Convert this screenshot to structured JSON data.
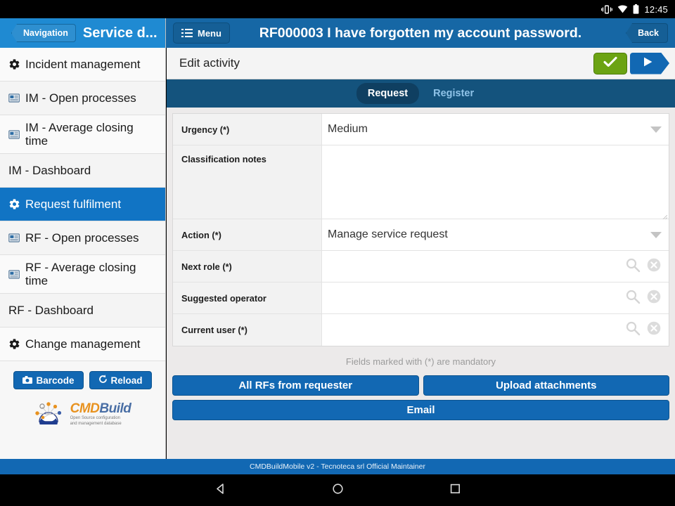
{
  "statusbar": {
    "time": "12:45",
    "icons": [
      "vibrate-icon",
      "wifi-icon",
      "battery-icon"
    ]
  },
  "appbar": {
    "navigation_label": "Navigation",
    "service_title": "Service d...",
    "menu_label": "Menu",
    "record_title": "RF000003 I have forgotten my account password.",
    "back_label": "Back"
  },
  "sidebar": {
    "items": [
      {
        "label": "Incident management",
        "icon": "gear-icon",
        "active": false
      },
      {
        "label": "IM - Open processes",
        "icon": "report-icon",
        "active": false
      },
      {
        "label": "IM - Average closing time",
        "icon": "report-icon",
        "active": false
      },
      {
        "label": "IM - Dashboard",
        "icon": "none",
        "active": false
      },
      {
        "label": "Request fulfilment",
        "icon": "gear-icon",
        "active": true
      },
      {
        "label": "RF - Open processes",
        "icon": "report-icon",
        "active": false
      },
      {
        "label": "RF - Average closing time",
        "icon": "report-icon",
        "active": false
      },
      {
        "label": "RF - Dashboard",
        "icon": "none",
        "active": false
      },
      {
        "label": "Change management",
        "icon": "gear-icon",
        "active": false
      }
    ],
    "barcode_label": "Barcode",
    "reload_label": "Reload",
    "logo": {
      "part1": "CMD",
      "part2": "Build",
      "tagline_line1": "Open Source configuration",
      "tagline_line2": "and management database"
    }
  },
  "content": {
    "header_title": "Edit activity",
    "confirm_icon": "check-icon",
    "advance_icon": "play-arrow-icon",
    "tabs": [
      {
        "label": "Request",
        "active": true
      },
      {
        "label": "Register",
        "active": false
      }
    ],
    "fields": [
      {
        "label": "Urgency (*)",
        "value": "Medium",
        "control": "dropdown"
      },
      {
        "label": "Classification notes",
        "value": "",
        "control": "textarea"
      },
      {
        "label": "Action (*)",
        "value": "Manage service request",
        "control": "dropdown"
      },
      {
        "label": "Next role (*)",
        "value": "",
        "control": "lookup"
      },
      {
        "label": "Suggested operator",
        "value": "",
        "control": "lookup"
      },
      {
        "label": "Current user (*)",
        "value": "",
        "control": "lookup"
      }
    ],
    "mandatory_note": "Fields marked with (*) are mandatory",
    "buttons": [
      {
        "label": "All RFs from requester"
      },
      {
        "label": "Upload attachments"
      },
      {
        "label": "Email"
      }
    ]
  },
  "footer": {
    "text": "CMDBuildMobile v2 - Tecnoteca srl Official Maintainer"
  },
  "navbar": {
    "back": "back-triangle-icon",
    "home": "home-circle-icon",
    "recents": "recents-square-icon"
  },
  "colors": {
    "brand_blue": "#1268b3",
    "dark_blue": "#14537d",
    "title_blue": "#1667a5",
    "light_blue": "#1f8ad2",
    "green": "#6ba313",
    "orange": "#e8921f"
  }
}
